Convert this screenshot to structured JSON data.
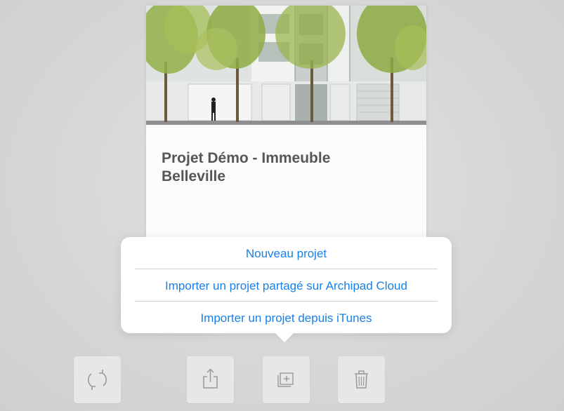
{
  "project_card": {
    "title": "Projet Démo - Immeuble Belleville",
    "thumbnail_icon": "building-facade-image"
  },
  "popover_menu": {
    "items": [
      {
        "label": "Nouveau projet"
      },
      {
        "label": "Importer un projet partagé sur Archipad Cloud"
      },
      {
        "label": "Importer un projet depuis iTunes"
      }
    ]
  },
  "toolbar": {
    "buttons": [
      {
        "icon": "sync-icon"
      },
      {
        "icon": "share-icon"
      },
      {
        "icon": "add-project-icon"
      },
      {
        "icon": "trash-icon"
      }
    ]
  },
  "colors": {
    "accent": "#1a80e6",
    "title_text": "#565656",
    "background": "#d6d6d6",
    "icon_gray": "#9a9a9a"
  }
}
